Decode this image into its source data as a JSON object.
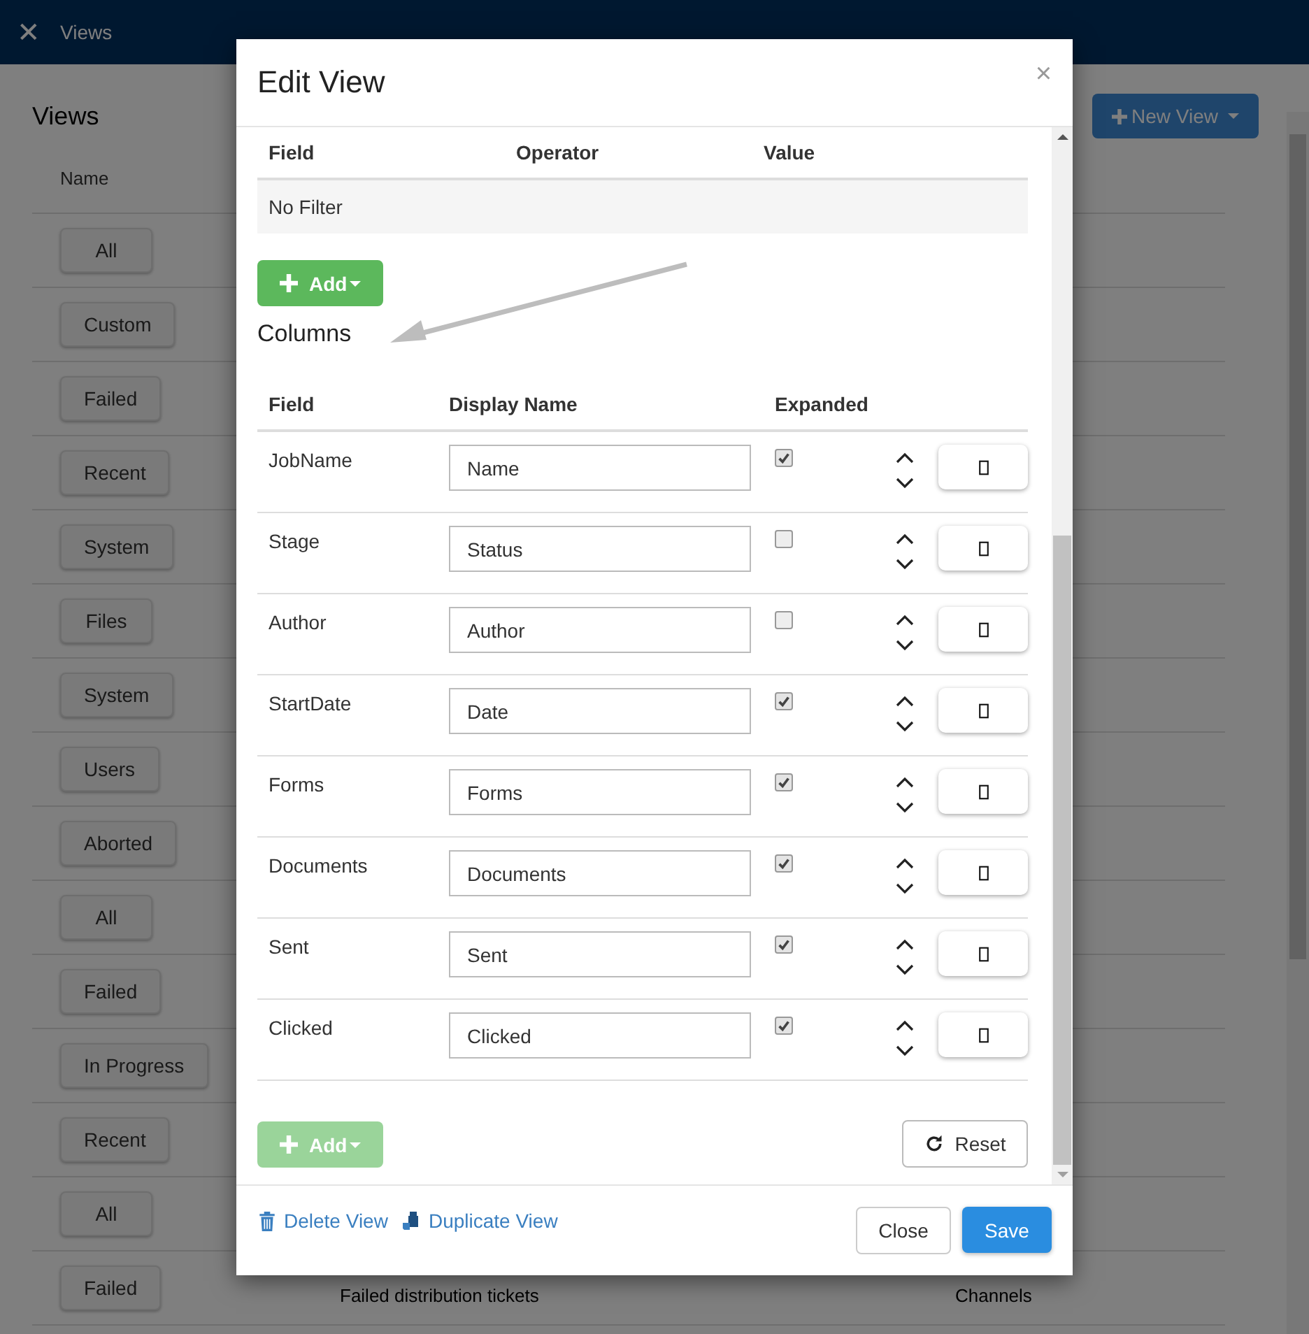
{
  "top_bar": {
    "close": "✕",
    "title": "Views"
  },
  "page": {
    "title": "Views",
    "new_button": "New View",
    "column": "Name",
    "rows": [
      {
        "name": "All"
      },
      {
        "name": "Custom"
      },
      {
        "name": "Failed"
      },
      {
        "name": "Recent"
      },
      {
        "name": "System"
      },
      {
        "name": "Files"
      },
      {
        "name": "System"
      },
      {
        "name": "Users"
      },
      {
        "name": "Aborted"
      },
      {
        "name": "All"
      },
      {
        "name": "Failed"
      },
      {
        "name": "In Progress"
      },
      {
        "name": "Recent"
      },
      {
        "name": "All"
      },
      {
        "name": "Failed",
        "description": "Failed distribution tickets",
        "category": "Channels"
      }
    ]
  },
  "dialog": {
    "title": "Edit View",
    "close": "×",
    "filters": {
      "columns": [
        "Field",
        "Operator",
        "Value"
      ],
      "empty": "No Filter",
      "add": {
        "label": "Add",
        "disabled": false
      }
    },
    "columns_title": "Columns",
    "columns": {
      "headers": [
        "Field",
        "Display Name",
        "Expanded"
      ],
      "rows": [
        {
          "field": "JobName",
          "display_name": "Name",
          "expanded": true
        },
        {
          "field": "Stage",
          "display_name": "Status",
          "expanded": false
        },
        {
          "field": "Author",
          "display_name": "Author",
          "expanded": false
        },
        {
          "field": "StartDate",
          "display_name": "Date",
          "expanded": true
        },
        {
          "field": "Forms",
          "display_name": "Forms",
          "expanded": true
        },
        {
          "field": "Documents",
          "display_name": "Documents",
          "expanded": true
        },
        {
          "field": "Sent",
          "display_name": "Sent",
          "expanded": true
        },
        {
          "field": "Clicked",
          "display_name": "Clicked",
          "expanded": true
        }
      ],
      "add": {
        "label": "Add",
        "disabled": true
      },
      "reset": "Reset"
    },
    "footer": {
      "delete": "Delete View",
      "duplicate": "Duplicate View",
      "close": "Close",
      "save": "Save"
    }
  }
}
